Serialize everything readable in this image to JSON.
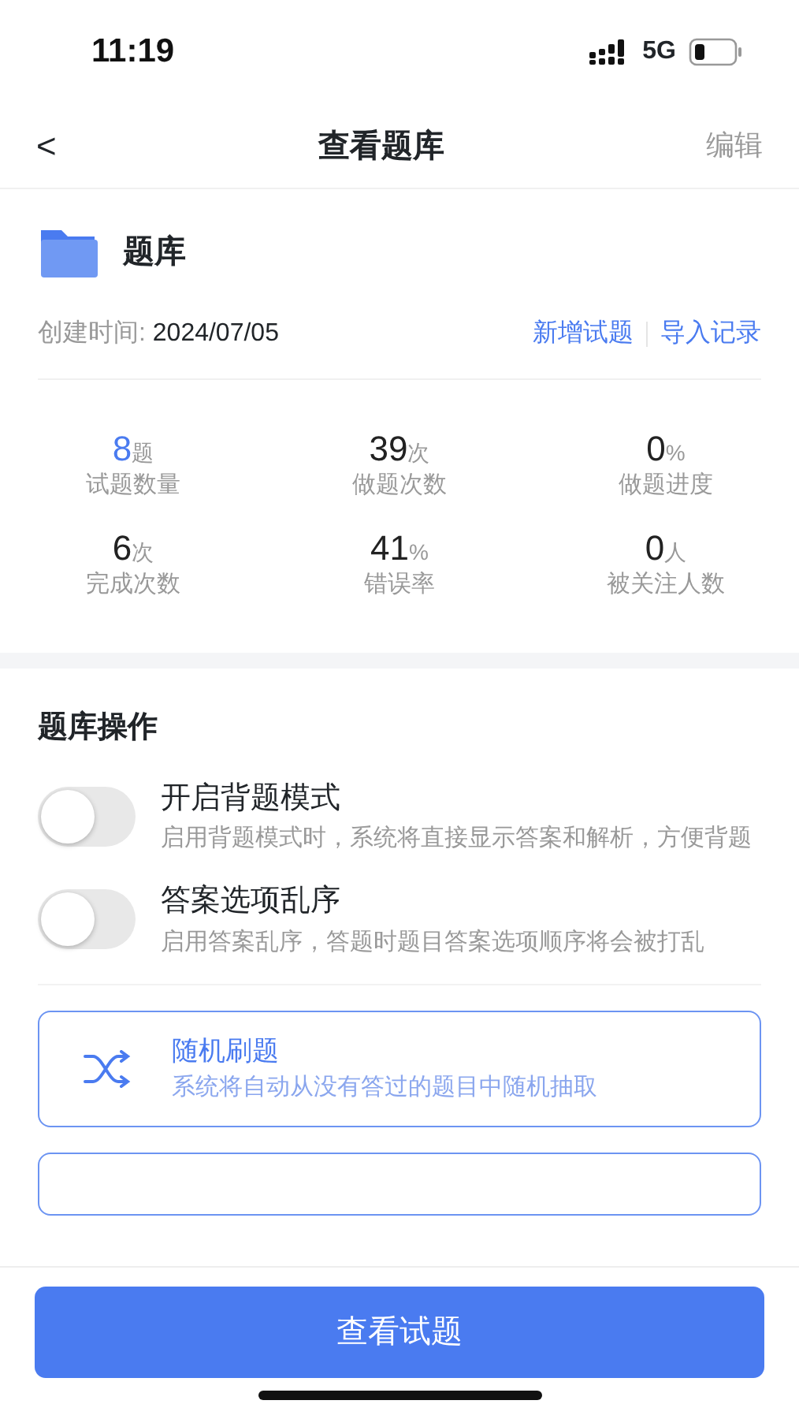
{
  "status_bar": {
    "time": "11:19",
    "network": "5G"
  },
  "nav": {
    "back": "<",
    "title": "查看题库",
    "action": "编辑"
  },
  "bank": {
    "name": "题库",
    "created_label": "创建时间: ",
    "created_date": "2024/07/05",
    "links": [
      "新增试题",
      "导入记录"
    ]
  },
  "stats": [
    {
      "value": "8",
      "unit": "题",
      "label": "试题数量",
      "accent": true
    },
    {
      "value": "39",
      "unit": "次",
      "label": "做题次数",
      "accent": false
    },
    {
      "value": "0",
      "unit": "%",
      "label": "做题进度",
      "accent": false
    },
    {
      "value": "6",
      "unit": "次",
      "label": "完成次数",
      "accent": false
    },
    {
      "value": "41",
      "unit": "%",
      "label": "错误率",
      "accent": false
    },
    {
      "value": "0",
      "unit": "人",
      "label": "被关注人数",
      "accent": false
    }
  ],
  "operations": {
    "title": "题库操作",
    "toggles": [
      {
        "label": "开启背题模式",
        "description": "启用背题模式时，系统将直接显示答案和解析，方便背题",
        "on": false
      },
      {
        "label": "答案选项乱序",
        "description": "启用答案乱序，答题时题目答案选项顺序将会被打乱",
        "on": false
      }
    ],
    "modes": [
      {
        "kind": "shuffle",
        "title": "随机刷题",
        "description": "系统将自动从没有答过的题目中随机抽取"
      },
      {
        "kind": "hidden"
      }
    ]
  },
  "footer": {
    "button": "查看试题"
  }
}
